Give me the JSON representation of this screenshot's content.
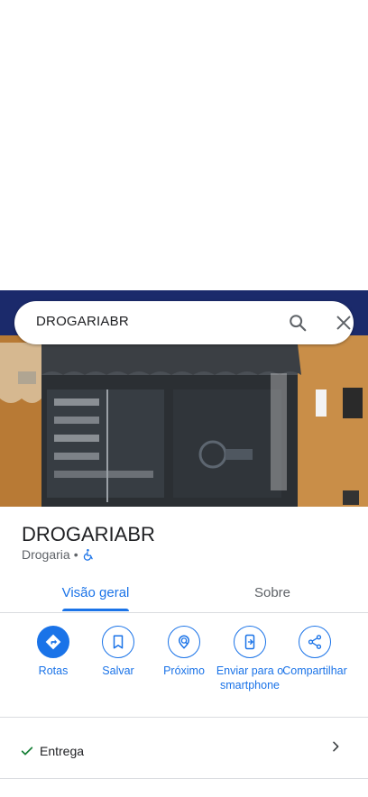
{
  "search": {
    "query": "DROGARIABR"
  },
  "place": {
    "name": "DROGARIABR",
    "category": "Drogaria",
    "separator": "•"
  },
  "tabs": [
    {
      "label": "Visão geral",
      "selected": true
    },
    {
      "label": "Sobre",
      "selected": false
    }
  ],
  "actions": [
    {
      "label": "Rotas",
      "icon": "directions-icon",
      "filled": true
    },
    {
      "label": "Salvar",
      "icon": "bookmark-icon",
      "filled": false
    },
    {
      "label": "Próximo",
      "icon": "nearby-icon",
      "filled": false
    },
    {
      "label": "Enviar para o smartphone",
      "icon": "send-to-phone-icon",
      "filled": false
    },
    {
      "label": "Compartilhar",
      "icon": "share-icon",
      "filled": false
    }
  ],
  "info_rows": [
    {
      "label": "Entrega",
      "icon": "check-icon"
    }
  ],
  "colors": {
    "accent": "#1a73e8",
    "check": "#188038",
    "text": "#202124",
    "subtext": "#5f6368"
  }
}
